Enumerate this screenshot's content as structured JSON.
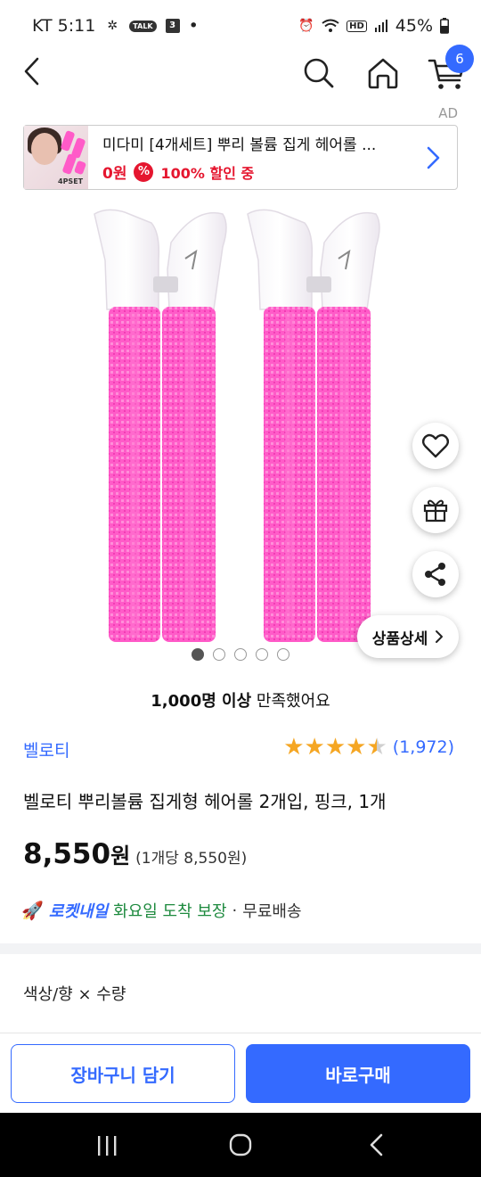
{
  "status_bar": {
    "carrier_time": "KT 5:11",
    "talk_badge": "TALK",
    "calendar_badge": "3",
    "dot": "•",
    "hd_badge": "HD",
    "battery": "45%"
  },
  "nav": {
    "cart_count": "6"
  },
  "ad": {
    "label": "AD",
    "title": "미다미 [4개세트] 뿌리 볼륨 집게 헤어롤 ...",
    "price": "0원",
    "discount_icon": "%",
    "discount": "100% 할인 중",
    "thumb_tag": "4PSET"
  },
  "product": {
    "detail_button": "상품상세",
    "satisfaction_bold": "1,000명 이상",
    "satisfaction_rest": " 만족했어요",
    "brand": "벨로티",
    "rating": 4.5,
    "rating_count": "(1,972)",
    "title": "벨로티 뿌리볼륨 집게형 헤어롤 2개입, 핑크, 1개",
    "price": "8,550",
    "price_unit": "원",
    "unit_price": "(1개당 8,550원)",
    "image_count": 5,
    "active_image": 0
  },
  "delivery": {
    "rocket": "로켓내일",
    "arrival": "화요일 도착 보장",
    "separator": "·",
    "free": "무료배송"
  },
  "options": {
    "label": "색상/향 × 수량"
  },
  "buttons": {
    "cart": "장바구니 담기",
    "buy": "바로구매"
  },
  "colors": {
    "accent": "#346aff",
    "star": "#f5a623",
    "discount_red": "#e5162f",
    "arrival_green": "#1d8a3e",
    "product_pink": "#ff5bc8"
  }
}
